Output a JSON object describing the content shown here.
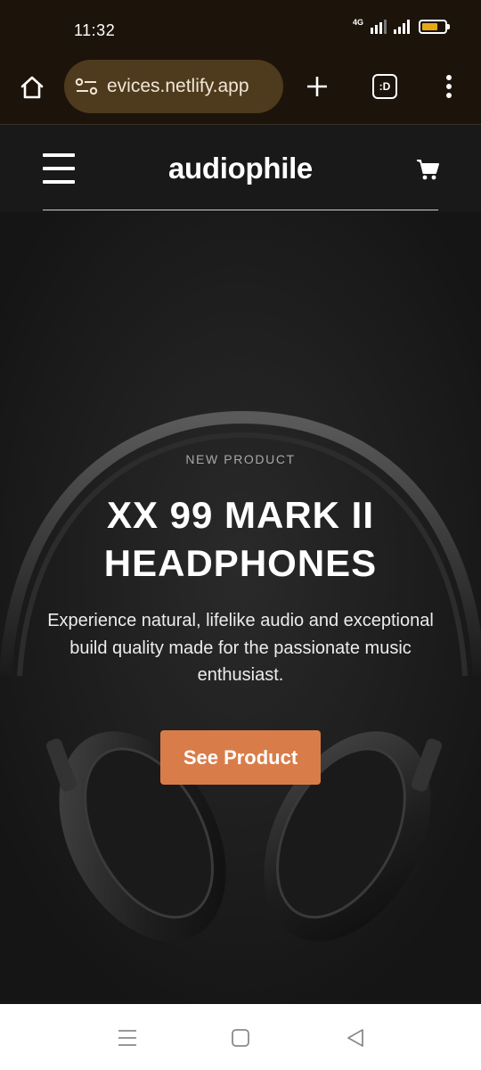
{
  "status_bar": {
    "time": "11:32",
    "network": "4G",
    "battery_level": 0.7,
    "battery_color": "#e6a817"
  },
  "browser": {
    "url_display": "evices.netlify.app",
    "tab_label": ":D",
    "icons": [
      "home-icon",
      "site-settings-icon",
      "new-tab-icon",
      "tab-switcher-icon",
      "more-menu-icon"
    ]
  },
  "site": {
    "logo": "audiophile",
    "icons": [
      "hamburger-menu-icon",
      "cart-icon"
    ]
  },
  "hero": {
    "overline": "NEW PRODUCT",
    "title": "XX 99 MARK II HEADPHONES",
    "description": "Experience natural, lifelike audio and exceptional build quality made for the passionate music enthusiast.",
    "cta_label": "See Product",
    "accent_color": "#d87d4a",
    "background_color": "#191919"
  },
  "nav_bar": {
    "icons": [
      "recents-icon",
      "home-circle-icon",
      "back-icon"
    ]
  }
}
